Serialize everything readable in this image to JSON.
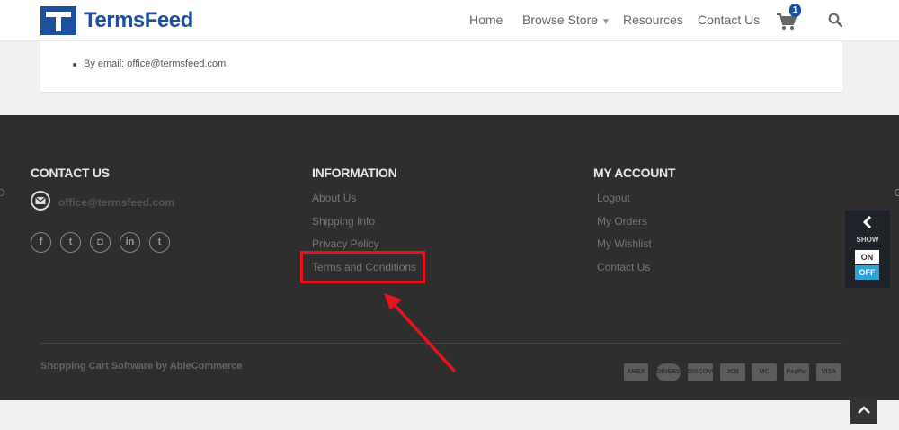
{
  "header": {
    "brand": "TermsFeed",
    "nav": [
      {
        "label": "Home"
      },
      {
        "label": "Browse Store"
      },
      {
        "label": "Resources"
      },
      {
        "label": "Contact Us"
      }
    ],
    "cart_count": "1",
    "icons": {
      "cart": "shopping-cart-icon",
      "search": "search-icon"
    }
  },
  "content": {
    "email_line": "By email: office@termsfeed.com"
  },
  "footer": {
    "contact": {
      "title": "CONTACT US",
      "email": "office@termsfeed.com",
      "social": [
        {
          "icon": "facebook-icon",
          "glyph": "f"
        },
        {
          "icon": "twitter-icon",
          "glyph": "t"
        },
        {
          "icon": "instagram-icon",
          "glyph": "◘"
        },
        {
          "icon": "linkedin-icon",
          "glyph": "in"
        },
        {
          "icon": "tumblr-icon",
          "glyph": "t"
        }
      ]
    },
    "information": {
      "title": "INFORMATION",
      "links": [
        "About Us",
        "Shipping Info",
        "Privacy Policy",
        "Terms and Conditions"
      ]
    },
    "account": {
      "title": "MY ACCOUNT",
      "links": [
        "Logout",
        "My Orders",
        "My Wishlist",
        "Contact Us"
      ]
    },
    "copyright": "Shopping Cart Software by AbleCommerce",
    "payments": [
      "AMEX",
      "DINERS",
      "DISCOVER",
      "JCB",
      "MC",
      "PayPal",
      "VISA"
    ]
  },
  "side_widget": {
    "show_label": "SHOW",
    "on_label": "ON",
    "off_label": "OFF"
  },
  "colors": {
    "brand": "#1c4f9c",
    "highlight": "#e8141c",
    "footer_bg": "#2e2e2e",
    "toggle_off": "#2ea3d8"
  }
}
